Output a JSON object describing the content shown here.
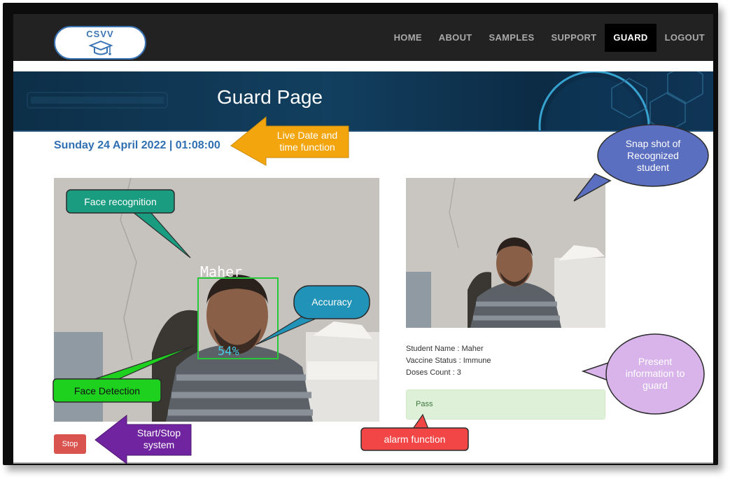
{
  "header": {
    "logo_text": "CSVV",
    "nav": [
      {
        "label": "HOME",
        "active": false
      },
      {
        "label": "ABOUT",
        "active": false
      },
      {
        "label": "SAMPLES",
        "active": false
      },
      {
        "label": "SUPPORT",
        "active": false
      },
      {
        "label": "GUARD",
        "active": true
      },
      {
        "label": "LOGOUT",
        "active": false
      }
    ]
  },
  "banner": {
    "title": "Guard Page"
  },
  "datetime": "Sunday 24 April 2022 | 01:08:00",
  "video": {
    "face_label": "Maher",
    "accuracy": "54%"
  },
  "student": {
    "name_line": "Student Name : Maher",
    "vaccine_line": "Vaccine Status : Immune",
    "doses_line": "Doses Count : 3"
  },
  "alarm": {
    "status": "Pass"
  },
  "controls": {
    "stop_label": "Stop"
  },
  "annotations": {
    "live_date": [
      "Live Date and",
      "time function"
    ],
    "snapshot": [
      "Snap shot of",
      "Recognized",
      "student"
    ],
    "face_recognition": "Face recognition",
    "accuracy": "Accuracy",
    "face_detection": "Face Detection",
    "present_info": [
      "Present",
      "information to",
      "guard"
    ],
    "start_stop": [
      "Start/Stop",
      "system"
    ],
    "alarm_function": "alarm function"
  },
  "colors": {
    "accent_blue": "#2f6fb2",
    "pass_green_bg": "#dff0d8",
    "stop_red": "#d9534f",
    "detect_green": "#27c83a"
  }
}
